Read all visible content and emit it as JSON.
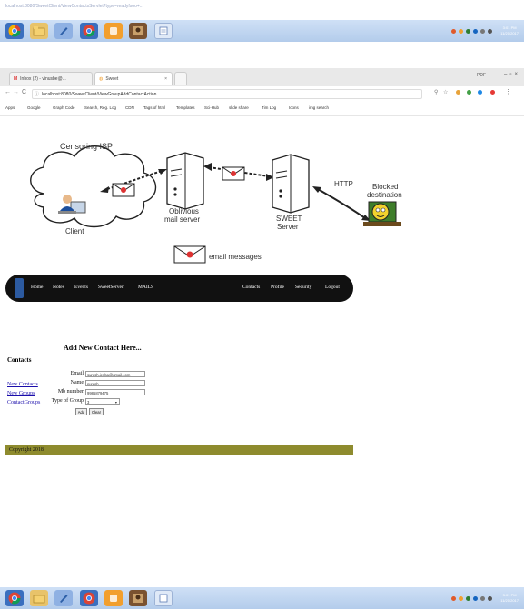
{
  "top_strip_url": "localhost:8080/SweetClient/ViewContactsServlet?type=readyfsoo+...",
  "taskbar": {
    "apps": [
      "Chrome",
      "File Explorer",
      "Pen",
      "Chrome",
      "App",
      "Photo",
      "Notes"
    ],
    "clock_time": "3:01 PM",
    "clock_date": "11/21/2017"
  },
  "browser": {
    "tabs": [
      "Inbox (2) - vinusbe@...",
      "Sweet"
    ],
    "window_user": "PDF",
    "url": "localhost:8080/SweetClient/ViewGroupAddContactAction",
    "bookmarks": [
      "Apps",
      "Google",
      "Graph Code",
      "Search, Reg. Log",
      "CDN",
      "Tags of html",
      "Templates",
      "Sci-Hub",
      "slide share",
      "Tim Log",
      "Icons",
      "img search"
    ]
  },
  "diagram": {
    "censoring_label": "Censoring ISP",
    "client_label": "Client",
    "oblivious_label_1": "Oblivious",
    "oblivious_label_2": "mail server",
    "sweet_label_1": "SWEET",
    "sweet_label_2": "Server",
    "http_label": "HTTP",
    "blocked_label_1": "Blocked",
    "blocked_label_2": "destination",
    "email_label": "email messages"
  },
  "nav": {
    "left": [
      "Home",
      "Notes",
      "Events",
      "SweetServer",
      "MAILS"
    ],
    "right": [
      "Contacts",
      "Profile",
      "Security",
      "Logout"
    ]
  },
  "sidebar": {
    "title": "Contacts",
    "links": [
      "New Contacts",
      "New Groups",
      "ContactGroups"
    ]
  },
  "form": {
    "heading": "Add New Contact Here...",
    "email_label": "Email",
    "email_value": "suresh.jeriba@gmail.com",
    "name_label": "Name",
    "name_value": "suresh",
    "mob_label": "Mb number",
    "mob_value": "9985879475",
    "group_label": "Type of Group",
    "group_value": "3",
    "add_label": "Add",
    "clear_label": "Clear"
  },
  "footer": {
    "text": "Copyright 2018"
  }
}
